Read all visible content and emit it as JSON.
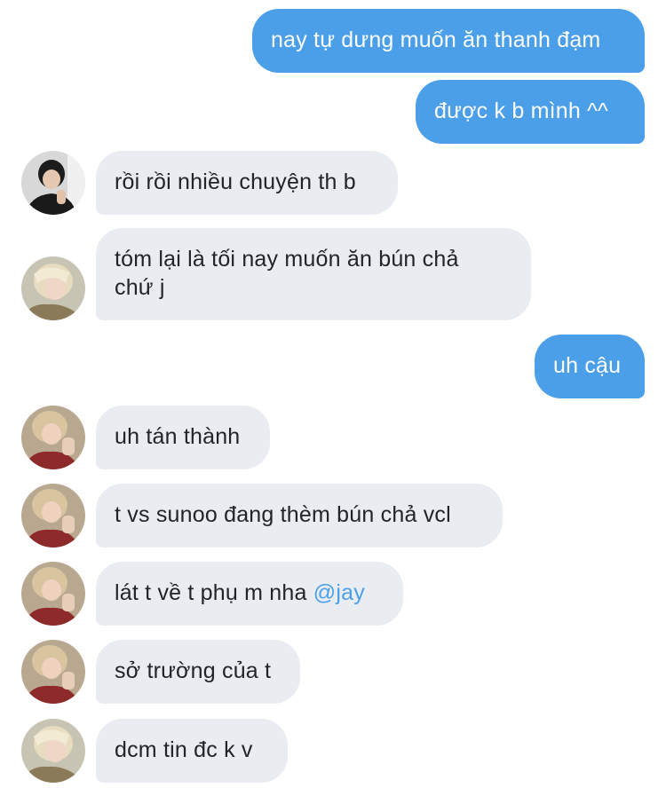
{
  "thread": {
    "messages": [
      {
        "direction": "out",
        "text": "nay tự dưng muốn ăn thanh đạm"
      },
      {
        "direction": "out",
        "text": "được k b mình ^^"
      },
      {
        "direction": "in",
        "avatar": "avatar-dark-hair",
        "text": "rồi rồi nhiều chuyện th b"
      },
      {
        "direction": "in",
        "avatar": "avatar-blonde-hair",
        "line1": "tóm lại là tối nay muốn ăn bún chả",
        "line2": "chứ j"
      },
      {
        "direction": "out",
        "text": "uh cậu"
      },
      {
        "direction": "in",
        "avatar": "avatar-red-shirt",
        "text": "uh tán thành"
      },
      {
        "direction": "in",
        "avatar": "avatar-red-shirt",
        "text": "t vs sunoo đang thèm bún chả vcl"
      },
      {
        "direction": "in",
        "avatar": "avatar-red-shirt",
        "text": "lát t về t phụ m nha ",
        "mention": "@jay"
      },
      {
        "direction": "in",
        "avatar": "avatar-red-shirt",
        "text": "sở trường của t"
      },
      {
        "direction": "in",
        "avatar": "avatar-blonde-hair",
        "text": "dcm tin đc k v"
      }
    ]
  },
  "colors": {
    "outgoing_bubble": "#4a9fe8",
    "incoming_bubble": "#e9ecf1",
    "incoming_text": "#222428",
    "mention": "#4a9fe8"
  }
}
